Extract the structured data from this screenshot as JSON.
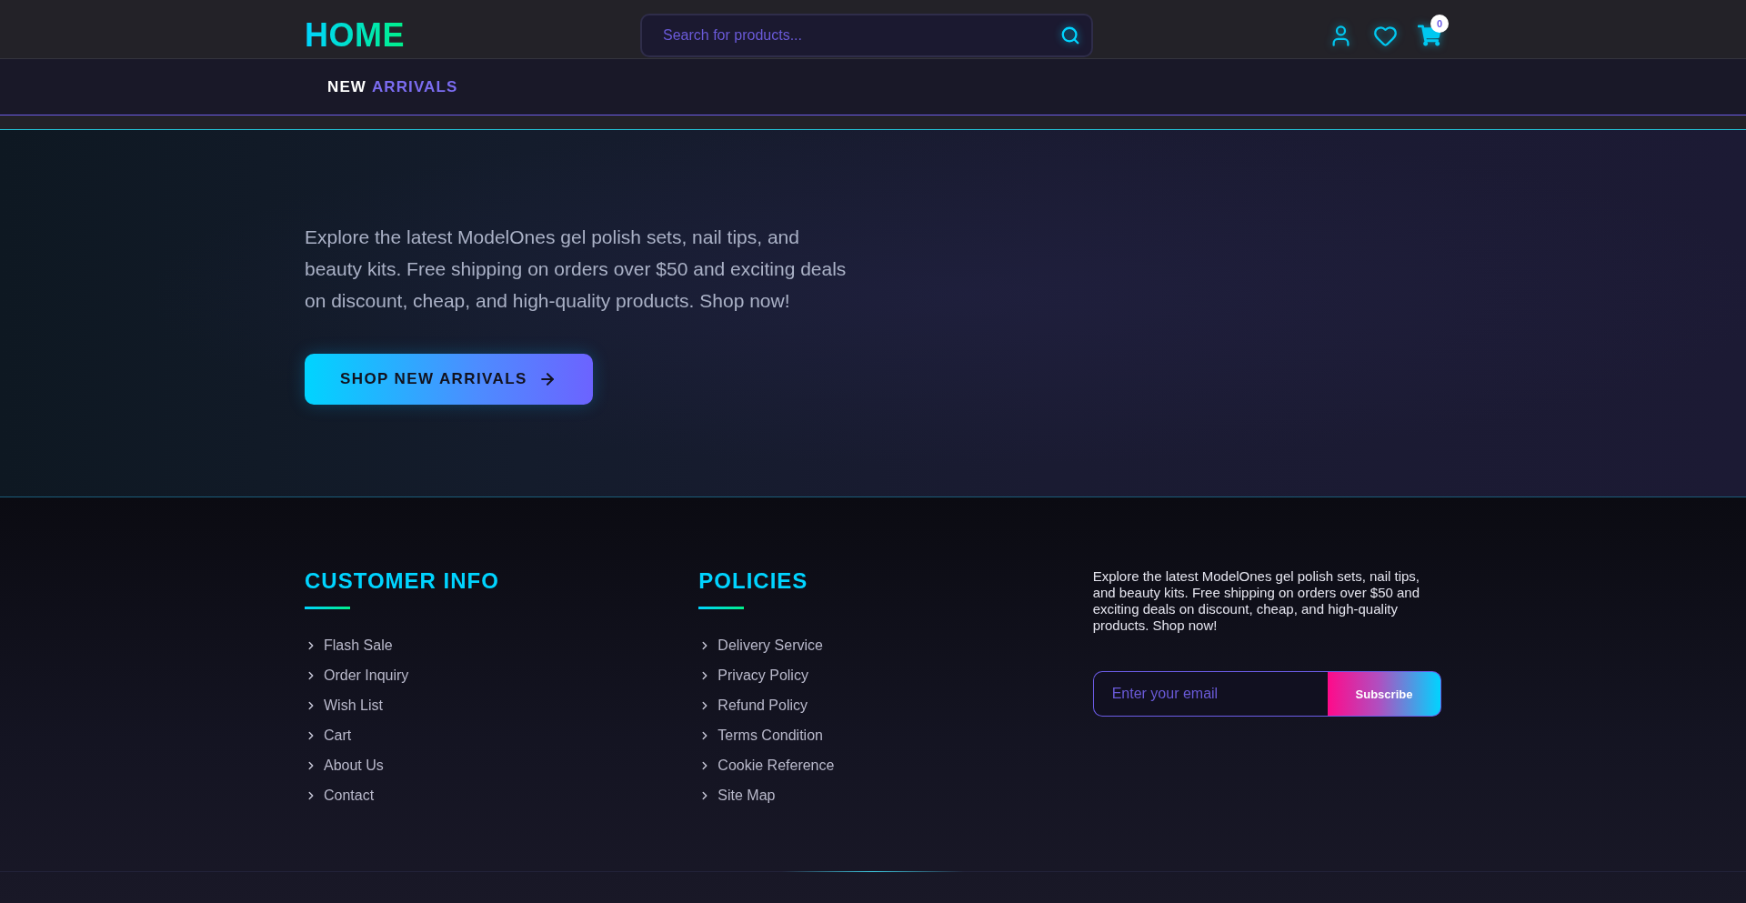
{
  "header": {
    "logo": "HOME",
    "search": {
      "placeholder": "Search for products..."
    },
    "cart_count": "0"
  },
  "nav": {
    "items": [
      {
        "label": "NEW",
        "accent": "ARRIVALS"
      }
    ]
  },
  "hero": {
    "text": "Explore the latest ModelOnes gel polish sets, nail tips, and beauty kits. Free shipping on orders over $50 and exciting deals on discount, cheap, and high-quality products. Shop now!",
    "button": "SHOP NEW ARRIVALS"
  },
  "footer": {
    "columns": [
      {
        "title": "CUSTOMER INFO",
        "links": [
          "Flash Sale",
          "Order Inquiry",
          "Wish List",
          "Cart",
          "About Us",
          "Contact"
        ]
      },
      {
        "title": "POLICIES",
        "links": [
          "Delivery Service",
          "Privacy Policy",
          "Refund Policy",
          "Terms Condition",
          "Cookie Reference",
          "Site Map"
        ]
      }
    ],
    "about": "Explore the latest ModelOnes gel polish sets, nail tips, and beauty kits. Free shipping on orders over $50 and exciting deals on discount, cheap, and high-quality products. Shop now!",
    "newsletter": {
      "placeholder": "Enter your email",
      "button": "Subscribe"
    }
  }
}
